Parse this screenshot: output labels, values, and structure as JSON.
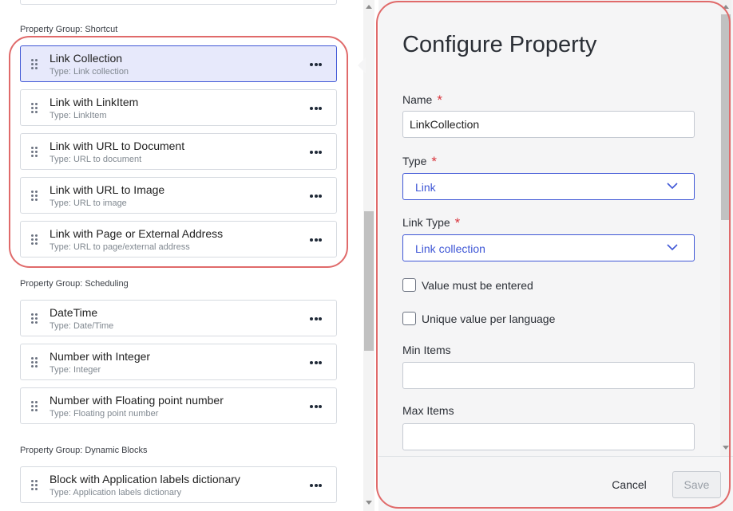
{
  "groups": [
    {
      "title": "Property Group: Shortcut",
      "items": [
        {
          "name": "Link Collection",
          "type": "Type: Link collection",
          "selected": true
        },
        {
          "name": "Link with LinkItem",
          "type": "Type: LinkItem"
        },
        {
          "name": "Link with URL to Document",
          "type": "Type: URL to document"
        },
        {
          "name": "Link with URL to Image",
          "type": "Type: URL to image"
        },
        {
          "name": "Link with Page or External Address",
          "type": "Type: URL to page/external address"
        }
      ]
    },
    {
      "title": "Property Group: Scheduling",
      "items": [
        {
          "name": "DateTime",
          "type": "Type: Date/Time"
        },
        {
          "name": "Number with Integer",
          "type": "Type: Integer"
        },
        {
          "name": "Number with Floating point number",
          "type": "Type: Floating point number"
        }
      ]
    },
    {
      "title": "Property Group: Dynamic Blocks",
      "items": [
        {
          "name": "Block with Application labels dictionary",
          "type": "Type: Application labels dictionary"
        }
      ]
    }
  ],
  "config": {
    "title": "Configure Property",
    "required_mark": "*",
    "name_label": "Name",
    "name_value": "LinkCollection",
    "type_label": "Type",
    "type_value": "Link",
    "link_type_label": "Link Type",
    "link_type_value": "Link collection",
    "value_required_label": "Value must be entered",
    "unique_label": "Unique value per language",
    "min_items_label": "Min Items",
    "min_items_value": "",
    "max_items_label": "Max Items",
    "max_items_value": "",
    "cancel_label": "Cancel",
    "save_label": "Save"
  },
  "colors": {
    "accent": "#3f57d6",
    "selected_bg": "#e7e9fb",
    "required": "#d9363e",
    "highlight": "#e06a6a"
  }
}
